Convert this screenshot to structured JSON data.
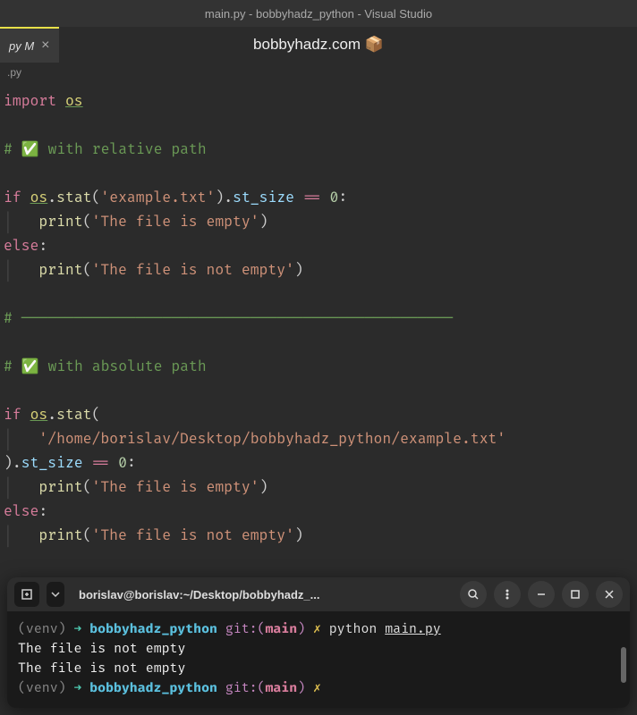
{
  "window": {
    "title": "main.py - bobbyhadz_python - Visual Studio"
  },
  "tab": {
    "label": "py M",
    "close": "×"
  },
  "watermark": "bobbyhadz.com 📦",
  "breadcrumb": ".py",
  "code": {
    "import": "import",
    "os": "os",
    "comment1_prefix": "#",
    "comment1_text": " with relative path",
    "if": "if",
    "stat": "stat",
    "str_rel": "'example.txt'",
    "st_size": "st_size",
    "eq": "==",
    "zero": "0",
    "colon": ":",
    "print": "print",
    "str_empty": "'The file is empty'",
    "else": "else",
    "str_notempty": "'The file is not empty'",
    "hr": "# ─────────────────────────────────────────────────",
    "comment2_text": " with absolute path",
    "str_abs": "'/home/borislav/Desktop/bobbyhadz_python/example.txt'",
    "paren_open": "(",
    "paren_close": ")",
    "dot": "."
  },
  "terminal": {
    "title": "borislav@borislav:~/Desktop/bobbyhadz_...",
    "venv": "(venv)",
    "arrow": "➜",
    "dir": "bobbyhadz_python",
    "git": "git:(",
    "branch": "main",
    "git_close": ")",
    "x": "✗",
    "cmd1": "python ",
    "cmd1_file": "main.py",
    "out1": "The file is not empty",
    "out2": "The file is not empty"
  }
}
